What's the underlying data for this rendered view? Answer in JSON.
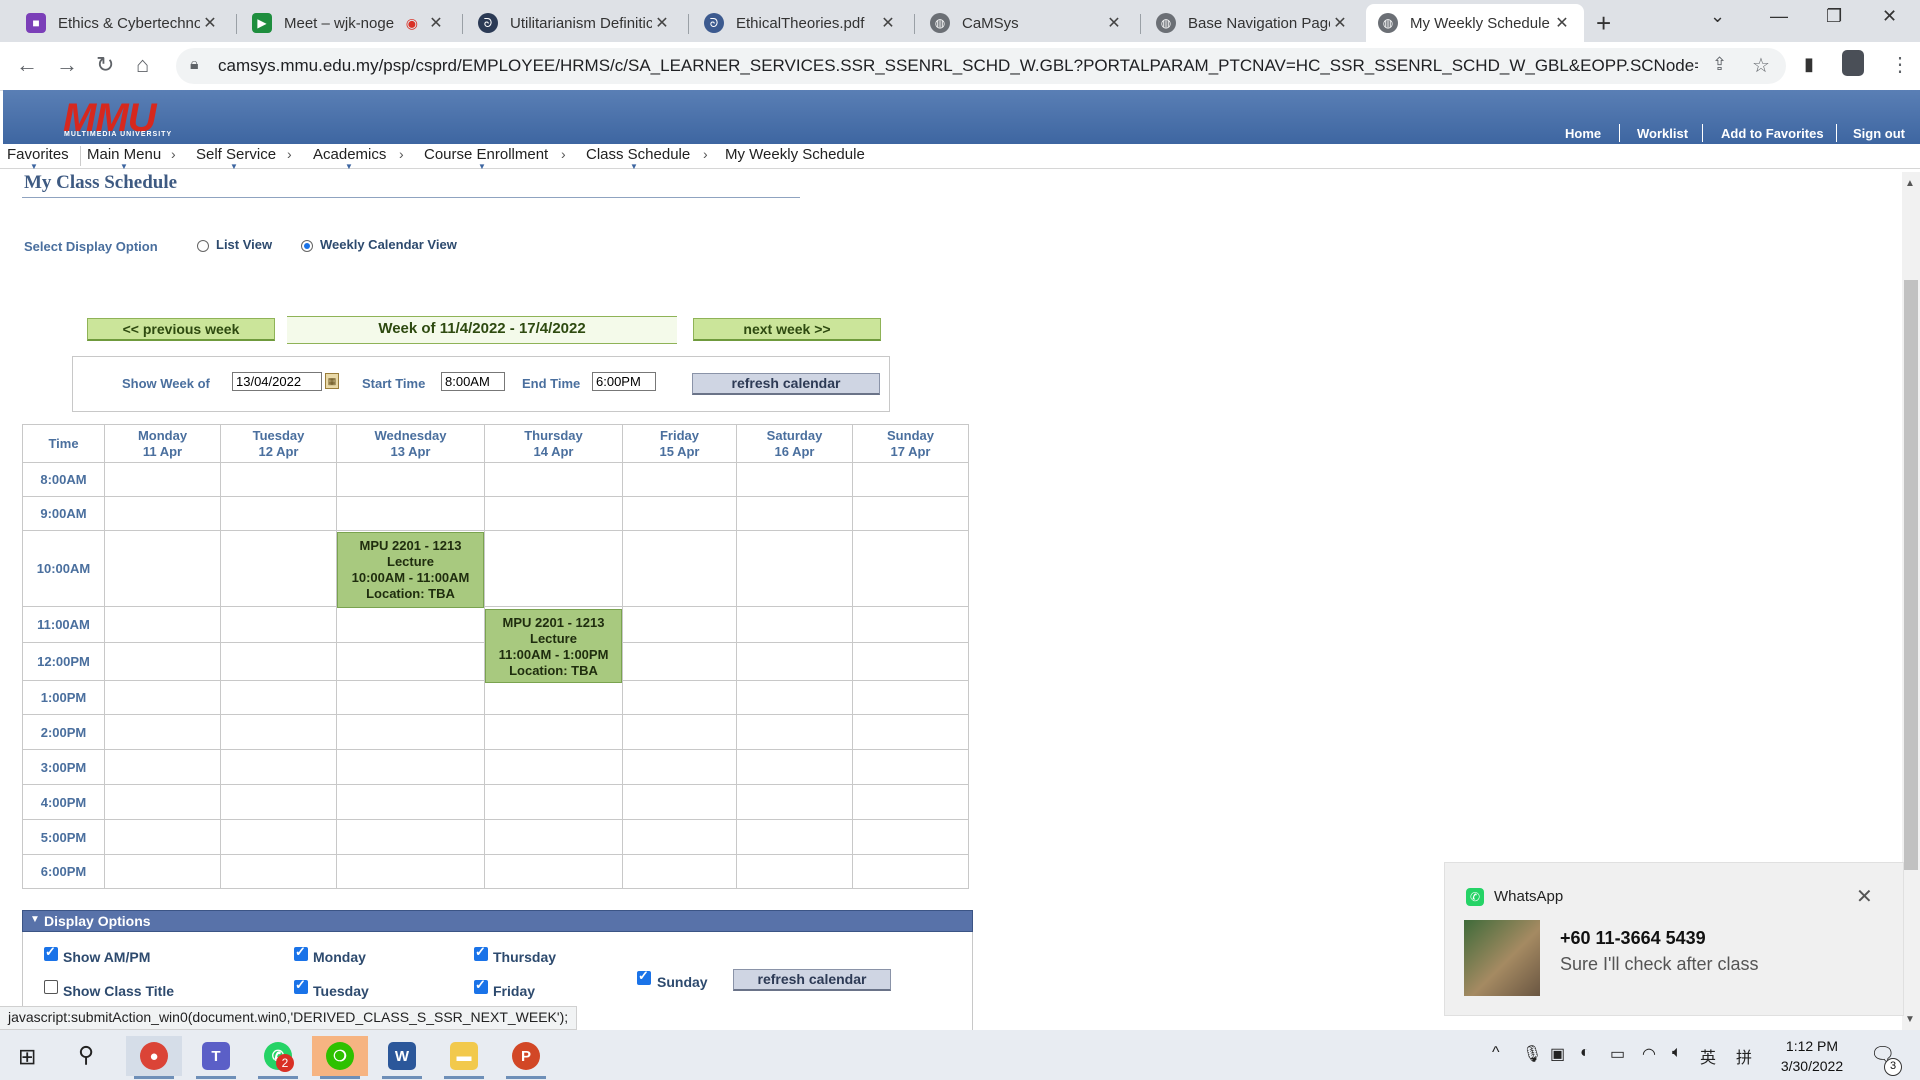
{
  "browser": {
    "tabs": [
      {
        "title": "Ethics & Cybertechnol",
        "favicon": "purple-square-icon"
      },
      {
        "title": "Meet – wjk-noge",
        "favicon": "google-meet-icon"
      },
      {
        "title": "Utilitarianism Definitic",
        "favicon": "globe-swirl-icon"
      },
      {
        "title": "EthicalTheories.pdf",
        "favicon": "pdf-swirl-icon"
      },
      {
        "title": "CaMSys",
        "favicon": "globe-icon"
      },
      {
        "title": "Base Navigation Page",
        "favicon": "globe-icon"
      },
      {
        "title": "My Weekly Schedule",
        "favicon": "globe-icon"
      }
    ],
    "url": "camsys.mmu.edu.my/psp/csprd/EMPLOYEE/HRMS/c/SA_LEARNER_SERVICES.SSR_SSENRL_SCHD_W.GBL?PORTALPARAM_PTCNAV=HC_SSR_SSENRL_SCHD_W_GBL&EOPP.SCNode=HRMS&EO..."
  },
  "header": {
    "logo": "MMU",
    "logo_sub": "MULTIMEDIA UNIVERSITY",
    "links": [
      "Home",
      "Worklist",
      "Add to Favorites",
      "Sign out"
    ]
  },
  "breadcrumbs": [
    "Favorites",
    "Main Menu",
    "Self Service",
    "Academics",
    "Course Enrollment",
    "Class Schedule",
    "My Weekly Schedule"
  ],
  "page": {
    "title": "My Class Schedule",
    "display_option_label": "Select Display Option",
    "list_view": "List View",
    "weekly_view": "Weekly Calendar View",
    "selected_view": "Weekly Calendar View",
    "prev_week": "<< previous week",
    "next_week": ">> next week",
    "next_week_label": "next week >>",
    "week_label": "Week of 11/4/2022 - 17/4/2022",
    "show_week_label": "Show Week of",
    "show_week_value": "13/04/2022",
    "start_time_label": "Start Time",
    "start_time_value": "8:00AM",
    "end_time_label": "End Time",
    "end_time_value": "6:00PM",
    "refresh": "refresh calendar"
  },
  "schedule": {
    "time_header": "Time",
    "days": [
      {
        "day": "Monday",
        "date": "11 Apr"
      },
      {
        "day": "Tuesday",
        "date": "12 Apr"
      },
      {
        "day": "Wednesday",
        "date": "13 Apr"
      },
      {
        "day": "Thursday",
        "date": "14 Apr"
      },
      {
        "day": "Friday",
        "date": "15 Apr"
      },
      {
        "day": "Saturday",
        "date": "16 Apr"
      },
      {
        "day": "Sunday",
        "date": "17 Apr"
      }
    ],
    "times": [
      "8:00AM",
      "9:00AM",
      "10:00AM",
      "11:00AM",
      "12:00PM",
      "1:00PM",
      "2:00PM",
      "3:00PM",
      "4:00PM",
      "5:00PM",
      "6:00PM"
    ],
    "classes": [
      {
        "day": "Wednesday",
        "course": "MPU 2201 - 1213",
        "type": "Lecture",
        "time": "10:00AM - 11:00AM",
        "location": "Location: TBA"
      },
      {
        "day": "Thursday",
        "course": "MPU 2201 - 1213",
        "type": "Lecture",
        "time": "11:00AM - 1:00PM",
        "location": "Location: TBA"
      }
    ]
  },
  "display_options": {
    "title": "Display Options",
    "items": [
      {
        "label": "Show AM/PM",
        "checked": true
      },
      {
        "label": "Show Class Title",
        "checked": false
      },
      {
        "label": "Monday",
        "checked": true
      },
      {
        "label": "Tuesday",
        "checked": true
      },
      {
        "label": "Thursday",
        "checked": true
      },
      {
        "label": "Friday",
        "checked": true
      },
      {
        "label": "Sunday",
        "checked": true
      }
    ],
    "refresh": "refresh calendar"
  },
  "status_bar": "javascript:submitAction_win0(document.win0,'DERIVED_CLASS_S_SSR_NEXT_WEEK');",
  "notification": {
    "app": "WhatsApp",
    "sender": "+60 11-3664 5439",
    "message": "Sure I'll check after class"
  },
  "taskbar": {
    "time": "1:12 PM",
    "date": "3/30/2022",
    "whatsapp_badge": "2",
    "notif_badge": "3",
    "ime_label": "英",
    "ime_label2": "拼"
  },
  "colors": {
    "header_blue": "#4a71aa",
    "class_green": "#a8c97f",
    "button_green": "#cbe59a",
    "options_bar": "#5872a9"
  }
}
